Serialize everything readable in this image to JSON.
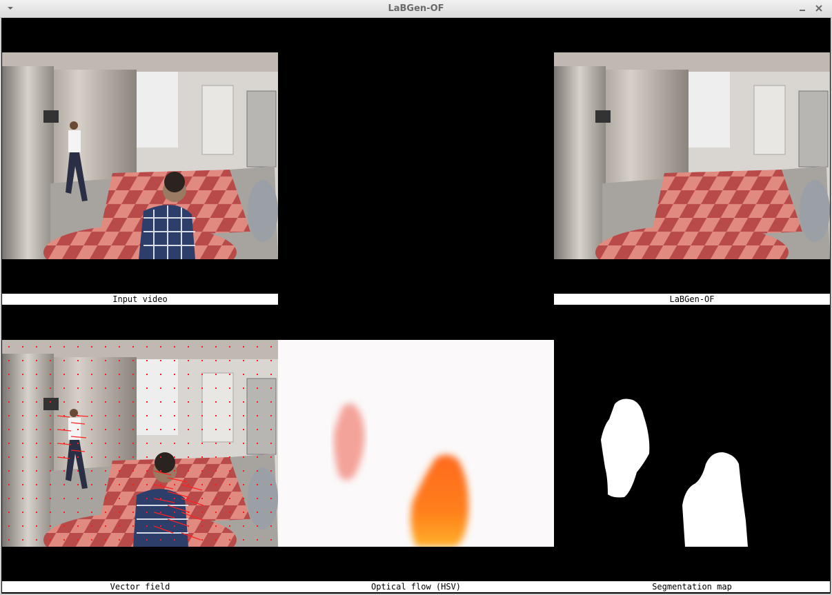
{
  "window": {
    "title": "LaBGen-OF"
  },
  "panels": {
    "input_video": {
      "label": "Input video"
    },
    "labgen_of": {
      "label": "LaBGen-OF"
    },
    "vector_field": {
      "label": "Vector field"
    },
    "optical_flow": {
      "label": "Optical flow (HSV)"
    },
    "segmentation": {
      "label": "Segmentation map"
    }
  },
  "icons": {
    "menu": "chevron-down-icon",
    "minimize": "minimize-icon",
    "close": "close-icon"
  }
}
